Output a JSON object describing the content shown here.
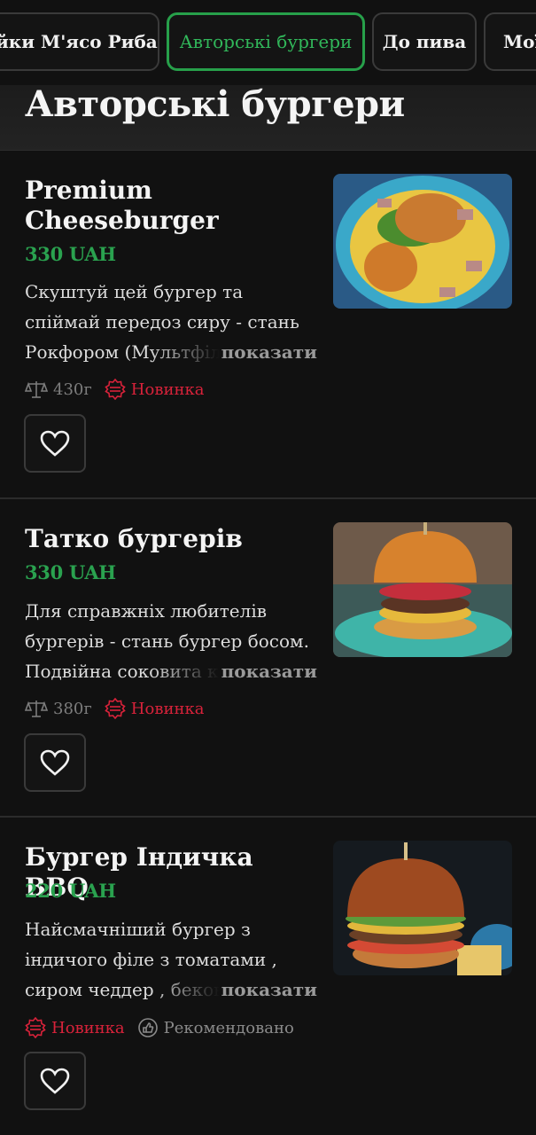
{
  "tabs": [
    {
      "label": "ейки М'ясо Риба"
    },
    {
      "label": "Авторські бургери",
      "active": true
    },
    {
      "label": "До пива"
    },
    {
      "label": "Мої"
    }
  ],
  "section": {
    "title": "Авторські бургери"
  },
  "more_label": "показати",
  "items": [
    {
      "name": "Premium Cheeseburger",
      "price": "330 UAH",
      "description": "Скуштуй цей бургер та спіймай передоз сиру - стань Рокфором (Мультфіл",
      "weight": "430г",
      "badges": [
        "Новинка"
      ],
      "photo_icon": "burger-photo"
    },
    {
      "name": "Татко бургерів",
      "price": "330 UAH",
      "description": "Для справжніх любителів бургерів - стань бургер босом. Подвійна соковита к",
      "weight": "380г",
      "badges": [
        "Новинка"
      ],
      "photo_icon": "burger-photo"
    },
    {
      "name": "Бургер Індичка BBQ",
      "price": "220 UAH",
      "description": "Найсмачніший бургер з індичого філе з томатами , сиром чеддер , бекон",
      "badges": [
        "Новинка",
        "Рекомендовано"
      ],
      "photo_icon": "burger-photo"
    }
  ],
  "colors": {
    "background": "#111111",
    "accent": "#2aa24f",
    "new_badge": "#d8223a"
  }
}
